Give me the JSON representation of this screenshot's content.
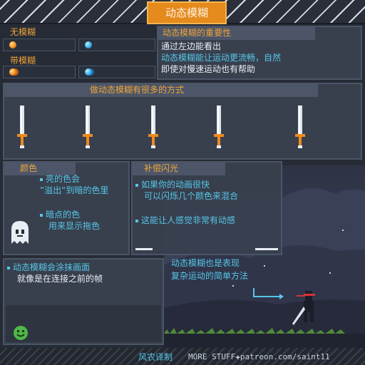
{
  "title": "动态模糊",
  "left_panel": {
    "no_blur_label": "无模糊",
    "with_blur_label": "带模糊"
  },
  "importance": {
    "header": "动态模糊的重要性",
    "line1": "通过左边能看出",
    "line2": "动态模糊能让运动更流畅，自然",
    "line3": "即使对慢速运动也有帮助"
  },
  "ways_header": "做动态模糊有很多的方式",
  "color_panel": {
    "header": "颜色",
    "line1": "亮的色会",
    "line2": "”溢出“到暗的色里",
    "line3": "暗点的色",
    "line4": "用来显示拖色"
  },
  "flash_panel": {
    "header": "补偿闪光",
    "line1": "如果你的动画很快",
    "line2": "可以闪烁几个颜色来混合",
    "line3": "这能让人感觉非常有动感"
  },
  "smear_panel": {
    "line1": "动态模糊会涂抹画面",
    "line2": "就像是在连接之前的帧"
  },
  "scene_text": {
    "line1": "动态模糊也是表现",
    "line2": "复杂运动的简单方法"
  },
  "footer": {
    "translator": "风农译制",
    "credit": "MORE STUFF✚patreon.com/saint11"
  },
  "colors": {
    "accent_orange": "#e58a1c",
    "header_text": "#f0a43a",
    "info_cyan": "#56c6e8",
    "panel_bg": "#38404e"
  },
  "icons": [
    "orange-orb-icon",
    "blue-orb-icon",
    "sword-icon",
    "ghost-icon",
    "green-smiley-icon",
    "arrow-right-icon",
    "ninja-figure"
  ]
}
